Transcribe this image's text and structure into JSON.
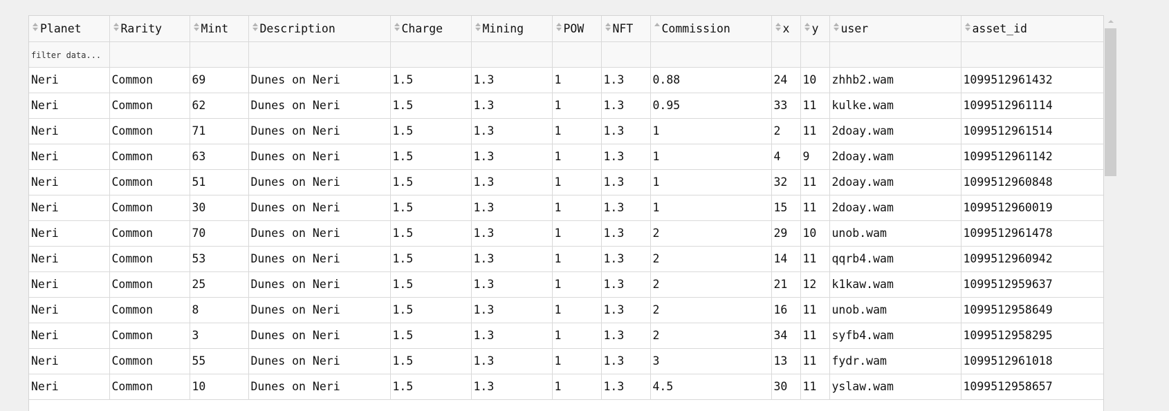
{
  "table": {
    "columns": [
      {
        "key": "planet",
        "label": "Planet",
        "sort": "none"
      },
      {
        "key": "rarity",
        "label": "Rarity",
        "sort": "none"
      },
      {
        "key": "mint",
        "label": "Mint",
        "sort": "none"
      },
      {
        "key": "description",
        "label": "Description",
        "sort": "none"
      },
      {
        "key": "charge",
        "label": "Charge",
        "sort": "none"
      },
      {
        "key": "mining",
        "label": "Mining",
        "sort": "none"
      },
      {
        "key": "pow",
        "label": "POW",
        "sort": "none"
      },
      {
        "key": "nft",
        "label": "NFT",
        "sort": "none"
      },
      {
        "key": "commission",
        "label": "Commission",
        "sort": "ascending"
      },
      {
        "key": "x",
        "label": "x",
        "sort": "none"
      },
      {
        "key": "y",
        "label": "y",
        "sort": "none"
      },
      {
        "key": "user",
        "label": "user",
        "sort": "none"
      },
      {
        "key": "asset_id",
        "label": "asset_id",
        "sort": "none"
      }
    ],
    "filter": {
      "placeholder": "filter data...",
      "value": ""
    },
    "rows": [
      [
        "Neri",
        "Common",
        "69",
        "Dunes on Neri",
        "1.5",
        "1.3",
        "1",
        "1.3",
        "0.88",
        "24",
        "10",
        "zhhb2.wam",
        "1099512961432"
      ],
      [
        "Neri",
        "Common",
        "62",
        "Dunes on Neri",
        "1.5",
        "1.3",
        "1",
        "1.3",
        "0.95",
        "33",
        "11",
        "kulke.wam",
        "1099512961114"
      ],
      [
        "Neri",
        "Common",
        "71",
        "Dunes on Neri",
        "1.5",
        "1.3",
        "1",
        "1.3",
        "1",
        "2",
        "11",
        "2doay.wam",
        "1099512961514"
      ],
      [
        "Neri",
        "Common",
        "63",
        "Dunes on Neri",
        "1.5",
        "1.3",
        "1",
        "1.3",
        "1",
        "4",
        "9",
        "2doay.wam",
        "1099512961142"
      ],
      [
        "Neri",
        "Common",
        "51",
        "Dunes on Neri",
        "1.5",
        "1.3",
        "1",
        "1.3",
        "1",
        "32",
        "11",
        "2doay.wam",
        "1099512960848"
      ],
      [
        "Neri",
        "Common",
        "30",
        "Dunes on Neri",
        "1.5",
        "1.3",
        "1",
        "1.3",
        "1",
        "15",
        "11",
        "2doay.wam",
        "1099512960019"
      ],
      [
        "Neri",
        "Common",
        "70",
        "Dunes on Neri",
        "1.5",
        "1.3",
        "1",
        "1.3",
        "2",
        "29",
        "10",
        "unob.wam",
        "1099512961478"
      ],
      [
        "Neri",
        "Common",
        "53",
        "Dunes on Neri",
        "1.5",
        "1.3",
        "1",
        "1.3",
        "2",
        "14",
        "11",
        "qqrb4.wam",
        "1099512960942"
      ],
      [
        "Neri",
        "Common",
        "25",
        "Dunes on Neri",
        "1.5",
        "1.3",
        "1",
        "1.3",
        "2",
        "21",
        "12",
        "k1kaw.wam",
        "1099512959637"
      ],
      [
        "Neri",
        "Common",
        "8",
        "Dunes on Neri",
        "1.5",
        "1.3",
        "1",
        "1.3",
        "2",
        "16",
        "11",
        "unob.wam",
        "1099512958649"
      ],
      [
        "Neri",
        "Common",
        "3",
        "Dunes on Neri",
        "1.5",
        "1.3",
        "1",
        "1.3",
        "2",
        "34",
        "11",
        "syfb4.wam",
        "1099512958295"
      ],
      [
        "Neri",
        "Common",
        "55",
        "Dunes on Neri",
        "1.5",
        "1.3",
        "1",
        "1.3",
        "3",
        "13",
        "11",
        "fydr.wam",
        "1099512961018"
      ],
      [
        "Neri",
        "Common",
        "10",
        "Dunes on Neri",
        "1.5",
        "1.3",
        "1",
        "1.3",
        "4.5",
        "30",
        "11",
        "yslaw.wam",
        "1099512958657"
      ]
    ]
  },
  "icons": {
    "sort": "sort-both-icon",
    "sort_asc": "sort-ascending-icon",
    "scroll_up": "scroll-up-arrow-icon"
  }
}
